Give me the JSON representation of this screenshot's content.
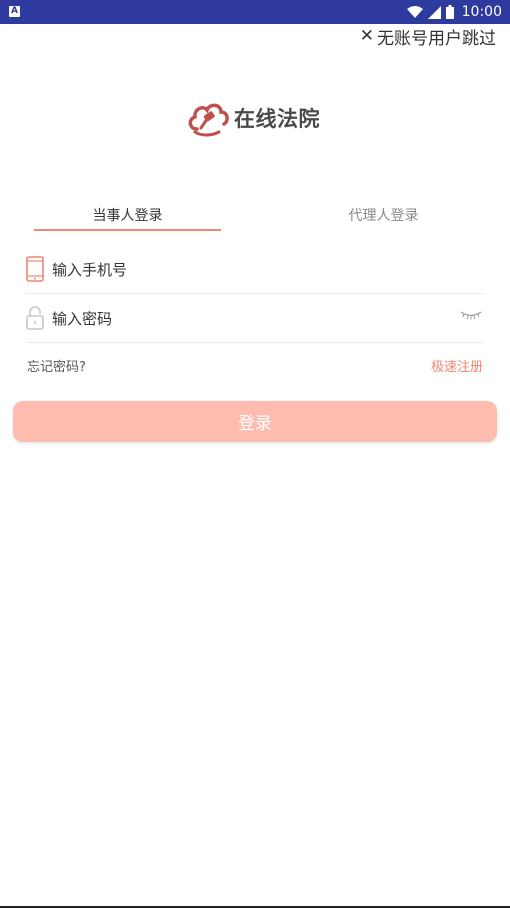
{
  "status_bar": {
    "notification_icon_letter": "A",
    "time": "10:00",
    "icons": [
      "wifi-icon",
      "signal-icon",
      "battery-icon"
    ]
  },
  "skip": {
    "icon": "close-icon",
    "label": "无账号用户跳过"
  },
  "logo": {
    "text": "在线法院",
    "icon": "cloud-gavel-icon"
  },
  "tabs": [
    {
      "label": "当事人登录",
      "active": true
    },
    {
      "label": "代理人登录",
      "active": false
    }
  ],
  "form": {
    "phone": {
      "placeholder": "输入手机号",
      "icon": "phone-icon"
    },
    "password": {
      "placeholder": "输入密码",
      "icon": "lock-icon",
      "toggle_icon": "eye-closed-icon"
    }
  },
  "links": {
    "forgot": "忘记密码?",
    "register": "极速注册"
  },
  "login_button": {
    "label": "登录"
  },
  "colors": {
    "accent": "#f0876f",
    "button": "#fdbcad",
    "status_bar": "#2f3a9e"
  }
}
